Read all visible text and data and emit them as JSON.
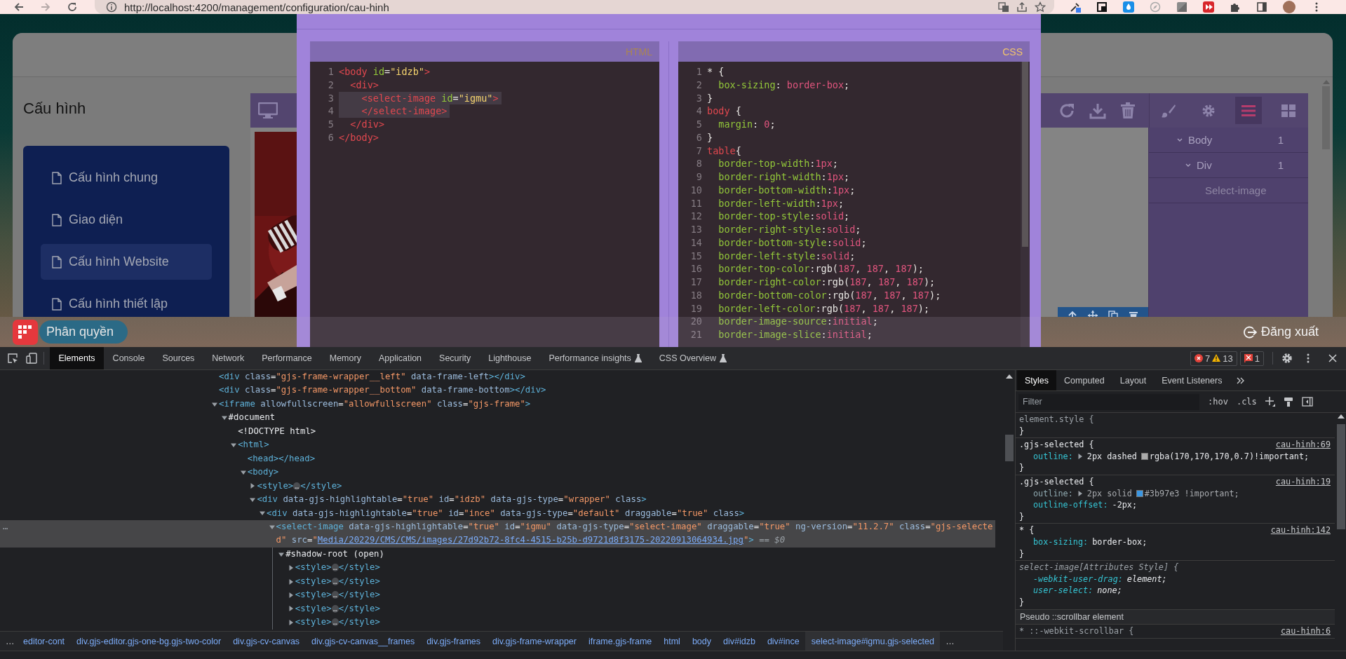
{
  "browser": {
    "url": "http://localhost:4200/management/configuration/cau-hinh"
  },
  "page": {
    "title": "Cấu hình",
    "menu": [
      {
        "label": "Cấu hình chung",
        "selected": false
      },
      {
        "label": "Giao diện",
        "selected": false
      },
      {
        "label": "Cấu hình Website",
        "selected": true
      },
      {
        "label": "Cấu hình thiết lập",
        "selected": false
      }
    ]
  },
  "editor": {
    "panel_buttons": [
      {
        "kind": "brush",
        "selected": false
      },
      {
        "kind": "gear",
        "selected": false
      },
      {
        "kind": "layers",
        "selected": true
      },
      {
        "kind": "blocks",
        "selected": false
      }
    ],
    "layers": [
      {
        "name": "Body",
        "count": "1",
        "expanded": true,
        "children": [
          {
            "name": "Div",
            "count": "1",
            "expanded": true,
            "children": [
              {
                "name": "Select-image"
              }
            ]
          }
        ]
      }
    ]
  },
  "code_modal": {
    "panels": [
      {
        "label": "HTML",
        "kind": "html",
        "line_numbers": [
          "1",
          "2",
          "3",
          "4",
          "5",
          "6"
        ],
        "lines": [
          {
            "text": "<body id=\"idzb\">",
            "selected": false
          },
          {
            "text": "  <div>",
            "selected": false
          },
          {
            "text": "    <select-image id=\"igmu\">",
            "selected": true
          },
          {
            "text": "    </select-image>",
            "selected": true
          },
          {
            "text": "  </div>",
            "selected": false
          },
          {
            "text": "</body>",
            "selected": false
          }
        ]
      },
      {
        "label": "CSS",
        "kind": "css",
        "line_numbers": [
          "1",
          "2",
          "3",
          "4",
          "5",
          "6",
          "7",
          "8",
          "9",
          "10",
          "11",
          "12",
          "13",
          "14",
          "15",
          "16",
          "17",
          "18",
          "19",
          "20",
          "21"
        ],
        "lines": [
          {
            "text": "* {",
            "selected": false
          },
          {
            "text": "  box-sizing: border-box;",
            "selected": false
          },
          {
            "text": "}",
            "selected": false
          },
          {
            "text": "body {",
            "selected": false
          },
          {
            "text": "  margin: 0;",
            "selected": false
          },
          {
            "text": "}",
            "selected": false
          },
          {
            "text": "table{",
            "selected": false
          },
          {
            "text": "  border-top-width:1px;",
            "selected": false
          },
          {
            "text": "  border-right-width:1px;",
            "selected": false
          },
          {
            "text": "  border-bottom-width:1px;",
            "selected": false
          },
          {
            "text": "  border-left-width:1px;",
            "selected": false
          },
          {
            "text": "  border-top-style:solid;",
            "selected": false
          },
          {
            "text": "  border-right-style:solid;",
            "selected": false
          },
          {
            "text": "  border-bottom-style:solid;",
            "selected": false
          },
          {
            "text": "  border-left-style:solid;",
            "selected": false
          },
          {
            "text": "  border-top-color:rgb(187, 187, 187);",
            "selected": false
          },
          {
            "text": "  border-right-color:rgb(187, 187, 187);",
            "selected": false
          },
          {
            "text": "  border-bottom-color:rgb(187, 187, 187);",
            "selected": false
          },
          {
            "text": "  border-left-color:rgb(187, 187, 187);",
            "selected": false
          },
          {
            "text": "  border-image-source:initial;",
            "selected": false
          },
          {
            "text": "  border-image-slice:initial;",
            "selected": false
          }
        ]
      }
    ]
  },
  "footer": {
    "role_button": "Phân quyền",
    "logout_label": "Đăng xuất"
  },
  "devtools": {
    "tabs": [
      {
        "label": "Elements",
        "selected": true,
        "experimental": false
      },
      {
        "label": "Console",
        "selected": false,
        "experimental": false
      },
      {
        "label": "Sources",
        "selected": false,
        "experimental": false
      },
      {
        "label": "Network",
        "selected": false,
        "experimental": false
      },
      {
        "label": "Performance",
        "selected": false,
        "experimental": false
      },
      {
        "label": "Memory",
        "selected": false,
        "experimental": false
      },
      {
        "label": "Application",
        "selected": false,
        "experimental": false
      },
      {
        "label": "Security",
        "selected": false,
        "experimental": false
      },
      {
        "label": "Lighthouse",
        "selected": false,
        "experimental": false
      },
      {
        "label": "Performance insights",
        "selected": false,
        "experimental": true
      },
      {
        "label": "CSS Overview",
        "selected": false,
        "experimental": true
      }
    ],
    "errors": "7",
    "warnings": "13",
    "issues": "1",
    "selected_marker": "…",
    "dom_tree": [
      {
        "text": "<div class=\"gjs-frame-wrapper__left\" data-frame-left></div>",
        "selected": false
      },
      {
        "text": "<div class=\"gjs-frame-wrapper__bottom\" data-frame-bottom></div>",
        "selected": false
      },
      {
        "text": "<iframe allowfullscreen=\"allowfullscreen\" class=\"gjs-frame\">",
        "selected": false,
        "expanded": true,
        "children": [
          {
            "text": "#document",
            "selected": false,
            "expanded": true,
            "children": [
              {
                "text": "<!DOCTYPE html>",
                "selected": false
              },
              {
                "text": "<html>",
                "selected": false,
                "expanded": true,
                "children": [
                  {
                    "text": "<head></head>",
                    "selected": false
                  },
                  {
                    "text": "<body>",
                    "selected": false,
                    "expanded": true,
                    "children": [
                      {
                        "text": "<style>…</style>",
                        "selected": false,
                        "expanded": false
                      },
                      {
                        "text": "<div data-gjs-highlightable=\"true\" id=\"idzb\" data-gjs-type=\"wrapper\" class>",
                        "selected": false,
                        "expanded": true,
                        "children": [
                          {
                            "text": "<div data-gjs-highlightable=\"true\" id=\"ince\" data-gjs-type=\"default\" draggable=\"true\" class>",
                            "selected": false,
                            "expanded": true,
                            "children": [
                              {
                                "text": "<select-image data-gjs-highlightable=\"true\" id=\"igmu\" data-gjs-type=\"select-image\" draggable=\"true\" ng-version=\"11.2.7\" class=\"gjs-selected\" src=\"",
                                "link": "Media/20229/CMS/CMS/images/27d92b72-8fc4-4515-b25b-d9721d8f3175-20220913064934.jpg",
                                "tail": "\">",
                                "note": "== $0",
                                "selected": true,
                                "expanded": true,
                                "children": [
                                  {
                                    "text": "#shadow-root (open)",
                                    "selected": false,
                                    "expanded": true,
                                    "children": [
                                      {
                                        "text": "<style>…</style>",
                                        "selected": false,
                                        "expanded": false
                                      },
                                      {
                                        "text": "<style>…</style>",
                                        "selected": false,
                                        "expanded": false
                                      },
                                      {
                                        "text": "<style>…</style>",
                                        "selected": false,
                                        "expanded": false
                                      },
                                      {
                                        "text": "<style>…</style>",
                                        "selected": false,
                                        "expanded": false
                                      },
                                      {
                                        "text": "<style>…</style>",
                                        "selected": false,
                                        "expanded": false
                                      }
                                    ]
                                  }
                                ]
                              }
                            ]
                          }
                        ]
                      }
                    ]
                  }
                ]
              }
            ]
          }
        ]
      }
    ],
    "breadcrumb": {
      "more_left": "…",
      "more_right": "…",
      "items": [
        {
          "label": "editor-cont",
          "selected": false
        },
        {
          "label": "div.gjs-editor.gjs-one-bg.gjs-two-color",
          "selected": false
        },
        {
          "label": "div.gjs-cv-canvas",
          "selected": false
        },
        {
          "label": "div.gjs-cv-canvas__frames",
          "selected": false
        },
        {
          "label": "div.gjs-frames",
          "selected": false
        },
        {
          "label": "div.gjs-frame-wrapper",
          "selected": false
        },
        {
          "label": "iframe.gjs-frame",
          "selected": false
        },
        {
          "label": "html",
          "selected": false
        },
        {
          "label": "body",
          "selected": false
        },
        {
          "label": "div#idzb",
          "selected": false
        },
        {
          "label": "div#ince",
          "selected": false
        },
        {
          "label": "select-image#igmu.gjs-selected",
          "selected": true
        }
      ]
    },
    "styles_pane": {
      "tabs": [
        {
          "label": "Styles",
          "selected": true
        },
        {
          "label": "Computed",
          "selected": false
        },
        {
          "label": "Layout",
          "selected": false
        },
        {
          "label": "Event Listeners",
          "selected": false
        }
      ],
      "filter_placeholder": "Filter",
      "toggles": [
        ":hov",
        ".cls"
      ],
      "rules": [
        {
          "kind": "inline",
          "selector": "element.style {",
          "close": "}"
        },
        {
          "kind": "rule",
          "selector": ".gjs-selected {",
          "source": "cau-hinh:69",
          "close": "}",
          "props": [
            {
              "name": "outline:",
              "value": "2px dashed",
              "expandable": true,
              "overridden": false,
              "color": "#aaaaaa",
              "color_text": "rgba(170,170,170,0.7)!important;"
            }
          ]
        },
        {
          "kind": "rule",
          "selector": ".gjs-selected {",
          "source": "cau-hinh:19",
          "close": "}",
          "props": [
            {
              "name": "outline:",
              "value": "2px solid",
              "expandable": true,
              "overridden": true,
              "color": "#3b97e3",
              "color_text": "#3b97e3 !important;"
            },
            {
              "name": "outline-offset:",
              "value": "-2px;",
              "expandable": false,
              "overridden": false
            }
          ]
        },
        {
          "kind": "rule",
          "selector": "* {",
          "source": "cau-hinh:142",
          "close": "}",
          "props": [
            {
              "name": "box-sizing:",
              "value": "border-box;",
              "expandable": false,
              "overridden": false
            }
          ]
        },
        {
          "kind": "attributes",
          "selector": "select-image[Attributes Style] {",
          "close": "}",
          "props": [
            {
              "name": "-webkit-user-drag:",
              "value": "element;",
              "expandable": false,
              "overridden": false
            },
            {
              "name": "user-select:",
              "value": "none;",
              "expandable": false,
              "overridden": false
            }
          ]
        },
        {
          "kind": "section",
          "title": "Pseudo ::scrollbar element"
        },
        {
          "kind": "partial",
          "selector": "* ::-webkit-scrollbar {",
          "source": "cau-hinh:6"
        }
      ]
    }
  }
}
